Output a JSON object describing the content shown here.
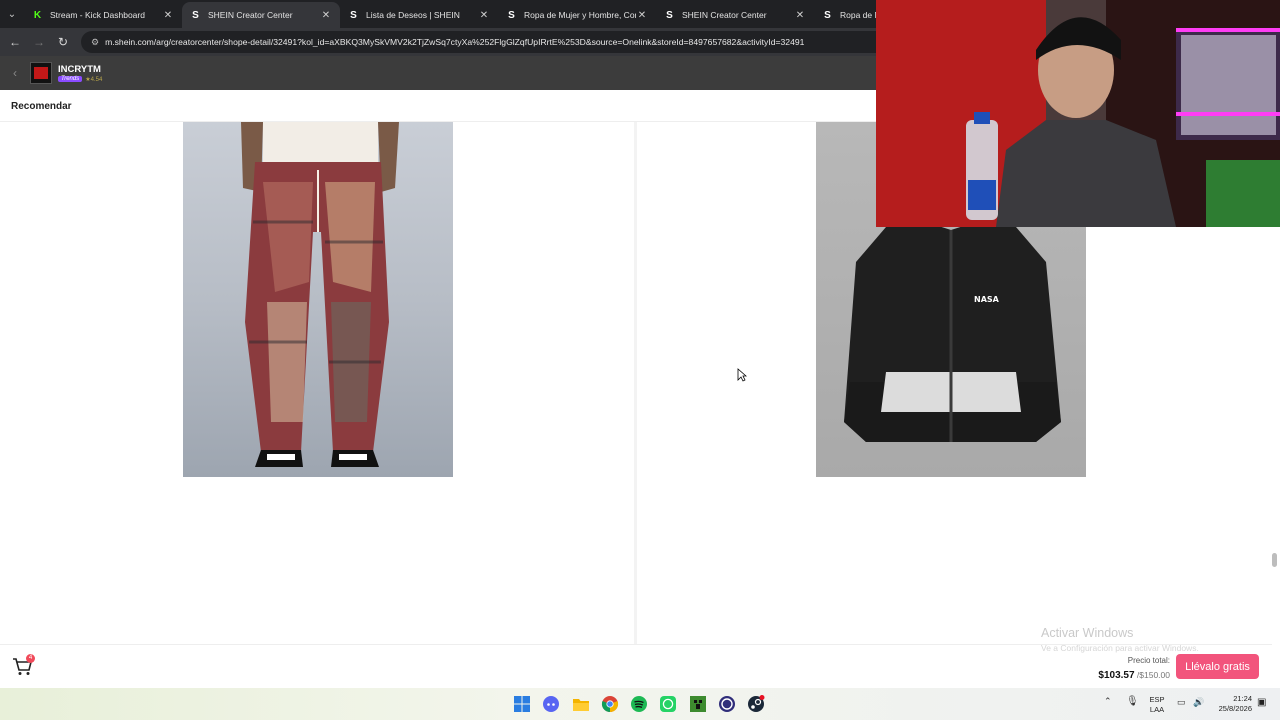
{
  "browser": {
    "tabs": [
      {
        "title": "Stream - Kick Dashboard",
        "favicon": "kick-icon",
        "active": false
      },
      {
        "title": "SHEIN Creator Center",
        "favicon": "shein-icon",
        "active": true
      },
      {
        "title": "Lista de Deseos | SHEIN",
        "favicon": "shein-icon",
        "active": false
      },
      {
        "title": "Ropa de Mujer y Hombre, Com",
        "favicon": "shein-icon",
        "active": false
      },
      {
        "title": "SHEIN Creator Center",
        "favicon": "shein-icon",
        "active": false
      },
      {
        "title": "Ropa de M",
        "favicon": "shein-icon",
        "active": false
      }
    ],
    "url": "m.shein.com/arg/creatorcenter/shope-detail/32491?kol_id=aXBKQ3MySkVMV2k2TjZwSq7ctyXa%252FlgGlZqfUpIRrtE%253D&source=Onelink&storeId=8497657682&activityId=32491"
  },
  "store": {
    "name": "INCRYTM",
    "badge": "Trends",
    "rating": "★4.54"
  },
  "section": {
    "title": "Recomendar"
  },
  "cart": {
    "badge_count": "4",
    "price_label": "Precio total:",
    "price_now": "$103.57",
    "price_goal": " /$150.00",
    "cta_label": "Llévalo gratis"
  },
  "watermark": {
    "title": "Activar Windows",
    "subtitle": "Ve a Configuración para activar Windows."
  },
  "product": {
    "jacket_print": "NASA"
  },
  "taskbar": {
    "icons": [
      "windows-start-icon",
      "discord-icon",
      "file-explorer-icon",
      "chrome-icon",
      "spotify-icon",
      "whatsapp-icon",
      "minecraft-icon",
      "obs-icon",
      "steam-icon"
    ],
    "lang_line1": "ESP",
    "lang_line2": "LAA",
    "time": "21:24",
    "date": "25/8/2026"
  },
  "colors": {
    "accent": "#f2547c",
    "tab_bar": "#202124",
    "store_header": "#3c3c3c",
    "kick_green": "#53fc18"
  }
}
